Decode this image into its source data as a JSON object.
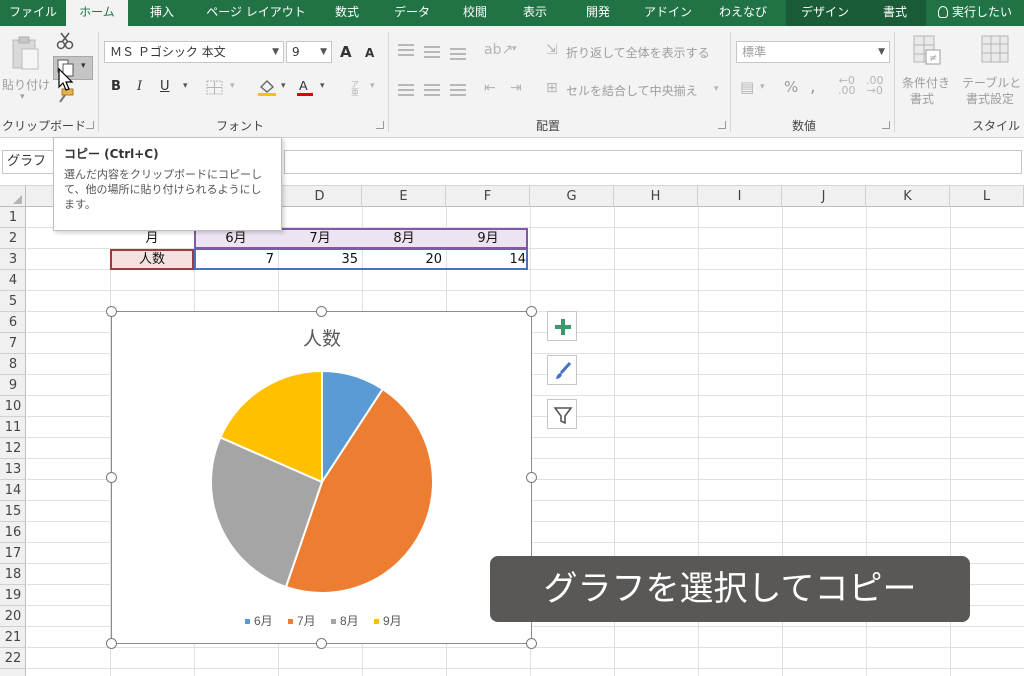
{
  "tabs": [
    {
      "label": "ファイル"
    },
    {
      "label": "ホーム"
    },
    {
      "label": "挿入"
    },
    {
      "label": "ページ レイアウト"
    },
    {
      "label": "数式"
    },
    {
      "label": "データ"
    },
    {
      "label": "校閲"
    },
    {
      "label": "表示"
    },
    {
      "label": "開発"
    },
    {
      "label": "アドイン"
    },
    {
      "label": "わえなび"
    },
    {
      "label": "デザイン"
    },
    {
      "label": "書式"
    }
  ],
  "tell_me": "実行したい",
  "ribbon": {
    "clipboard": {
      "label": "クリップボード",
      "paste_label": "貼り付け"
    },
    "font": {
      "label": "フォント",
      "font_name": "ＭＳ Ｐゴシック 本文",
      "font_size": "9",
      "bold": "B",
      "italic": "I",
      "underline": "U",
      "grow": "A",
      "shrink": "A"
    },
    "alignment": {
      "label": "配置",
      "wrap_text": "折り返して全体を表示する",
      "merge_center": "セルを結合して中央揃え"
    },
    "number": {
      "label": "数値",
      "format": "標準",
      "percent": "%",
      "comma": ","
    },
    "styles": {
      "label": "スタイル",
      "conditional": "条件付き",
      "conditional2": "書式",
      "table": "テーブルとし",
      "table2": "書式設定"
    }
  },
  "name_box": "グラフ",
  "tooltip": {
    "title": "コピー (Ctrl+C)",
    "body": "選んだ内容をクリップボードにコピーして、他の場所に貼り付けられるようにします。"
  },
  "columns": [
    "D",
    "E",
    "F",
    "G",
    "H",
    "I",
    "J",
    "K",
    "L"
  ],
  "rows": [
    "1",
    "2",
    "3",
    "4",
    "5",
    "6",
    "7",
    "8",
    "9",
    "10",
    "11",
    "12",
    "13",
    "14",
    "15",
    "16",
    "17",
    "18",
    "19",
    "20",
    "21",
    "22"
  ],
  "table": {
    "header_label": "月",
    "row_label": "人数",
    "months": [
      "6月",
      "7月",
      "8月",
      "9月"
    ],
    "counts": [
      "7",
      "35",
      "20",
      "14"
    ]
  },
  "chart_data": {
    "type": "pie",
    "title": "人数",
    "categories": [
      "6月",
      "7月",
      "8月",
      "9月"
    ],
    "values": [
      7,
      35,
      20,
      14
    ],
    "colors": [
      "#5b9bd5",
      "#ed7d31",
      "#a5a5a5",
      "#ffc000"
    ],
    "legend": "bottom"
  },
  "caption": "グラフを選択してコピー"
}
